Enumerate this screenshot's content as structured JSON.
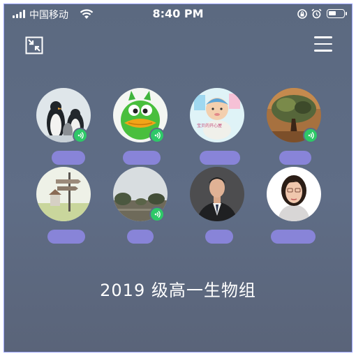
{
  "status_bar": {
    "carrier": "中国移动",
    "time": "8:40 PM",
    "battery_level": 0.5
  },
  "toolbar": {
    "left_icon": "shrink-window-icon",
    "right_icon": "menu-icon"
  },
  "participants": [
    {
      "avatar": "penguins",
      "speaking": true
    },
    {
      "avatar": "green-cartoon-bird",
      "speaking": true
    },
    {
      "avatar": "baby-photo",
      "speaking": false
    },
    {
      "avatar": "tree-painting",
      "speaking": true
    },
    {
      "avatar": "signpost-town",
      "speaking": false
    },
    {
      "avatar": "landscape-trees",
      "speaking": true
    },
    {
      "avatar": "man-in-suit",
      "speaking": false
    },
    {
      "avatar": "woman-with-glasses",
      "speaking": false
    }
  ],
  "group_name": "2019 级高一生物组",
  "colors": {
    "background": "#5d6b83",
    "speaking_badge": "#2ec868",
    "name_pill": "#8a86dc"
  }
}
